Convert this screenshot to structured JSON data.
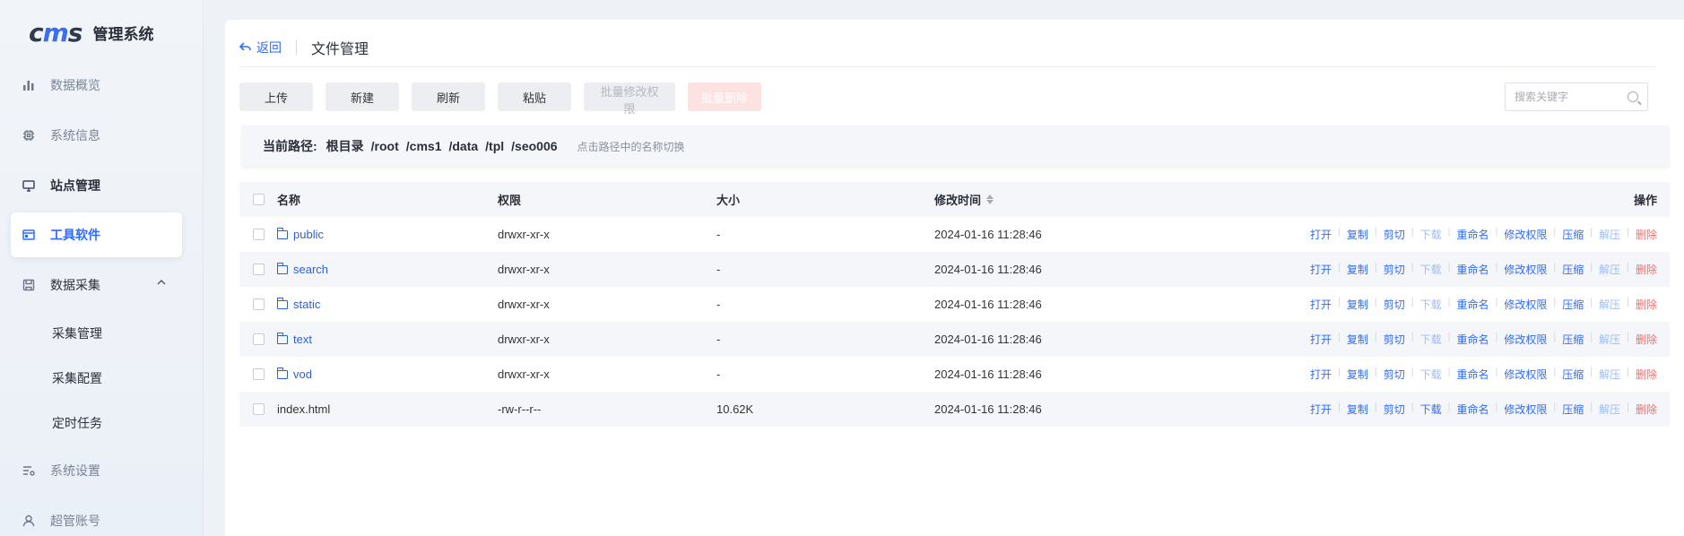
{
  "app": {
    "logo_mark": "cms",
    "title": "管理系统"
  },
  "sidebar": {
    "items": [
      {
        "label": "数据概览",
        "icon": "bar-chart-icon"
      },
      {
        "label": "系统信息",
        "icon": "chip-icon"
      },
      {
        "label": "站点管理",
        "icon": "monitor-icon"
      },
      {
        "label": "工具软件",
        "icon": "window-icon"
      },
      {
        "label": "数据采集",
        "icon": "save-icon"
      },
      {
        "label": "系统设置",
        "icon": "settings-list-icon"
      },
      {
        "label": "超管账号",
        "icon": "user-icon"
      }
    ],
    "sub_items": [
      "采集管理",
      "采集配置",
      "定时任务"
    ]
  },
  "header": {
    "back_label": "返回",
    "title": "文件管理"
  },
  "toolbar": {
    "upload": "上传",
    "new": "新建",
    "refresh": "刷新",
    "paste": "粘贴",
    "batch_chmod": "批量修改权限",
    "batch_delete": "批量删除"
  },
  "search": {
    "placeholder": "搜索关键字"
  },
  "path": {
    "label": "当前路径:",
    "segments": [
      "根目录",
      "/root",
      "/cms1",
      "/data",
      "/tpl",
      "/seo006"
    ],
    "hint": "点击路径中的名称切换"
  },
  "table": {
    "headers": {
      "name": "名称",
      "perm": "权限",
      "size": "大小",
      "mtime": "修改时间",
      "ops": "操作"
    },
    "ops": [
      "打开",
      "复制",
      "剪切",
      "下载",
      "重命名",
      "修改权限",
      "压缩",
      "解压",
      "删除"
    ],
    "rows": [
      {
        "name": "public",
        "type": "folder",
        "perm": "drwxr-xr-x",
        "size": "-",
        "mtime": "2024-01-16 11:28:46"
      },
      {
        "name": "search",
        "type": "folder",
        "perm": "drwxr-xr-x",
        "size": "-",
        "mtime": "2024-01-16 11:28:46"
      },
      {
        "name": "static",
        "type": "folder",
        "perm": "drwxr-xr-x",
        "size": "-",
        "mtime": "2024-01-16 11:28:46"
      },
      {
        "name": "text",
        "type": "folder",
        "perm": "drwxr-xr-x",
        "size": "-",
        "mtime": "2024-01-16 11:28:46"
      },
      {
        "name": "vod",
        "type": "folder",
        "perm": "drwxr-xr-x",
        "size": "-",
        "mtime": "2024-01-16 11:28:46"
      },
      {
        "name": "index.html",
        "type": "file",
        "perm": "-rw-r--r--",
        "size": "10.62K",
        "mtime": "2024-01-16 11:28:46"
      }
    ]
  },
  "colors": {
    "accent": "#2f6bff",
    "danger": "#f56c6c",
    "sidebar_bg": "#eef2f8"
  }
}
